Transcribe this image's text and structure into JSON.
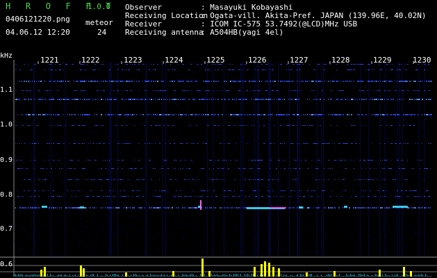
{
  "app": {
    "title": "H R O F F T",
    "version": "1.0.0"
  },
  "file": {
    "name": "0406121220.png",
    "datetime": "04.06.12 12:20"
  },
  "meteor": {
    "label": "meteor",
    "count": "24"
  },
  "info": [
    {
      "label": "Observer",
      "value": ": Masayuki Kobayashi"
    },
    {
      "label": "Receiving Location",
      "value": ": Ogata-vill. Akita-Pref. JAPAN (139.96E, 40.02N)"
    },
    {
      "label": "Receiver",
      "value": ": ICOM IC-575 53.7492(@LCD)MHz USB"
    },
    {
      "label": "Receiving antenna",
      "value": ": A504HB(yagi 4el)"
    }
  ],
  "axis": {
    "unit": "kHz",
    "freq_labels": [
      "1.1",
      "1.0",
      "0.9",
      "0.8",
      "0.7",
      "0.6"
    ],
    "time_labels": [
      "1221",
      "1222",
      "1223",
      "1224",
      "1225",
      "1226",
      "1227",
      "1228",
      "1229",
      "1230"
    ]
  },
  "colors": {
    "header_green": "#4cd84c",
    "text": "#ffffff",
    "background": "#000000",
    "signal_blue": "#3050ff",
    "signal_cyan": "#40e0ff",
    "hist_yellow": "#ffff00"
  }
}
